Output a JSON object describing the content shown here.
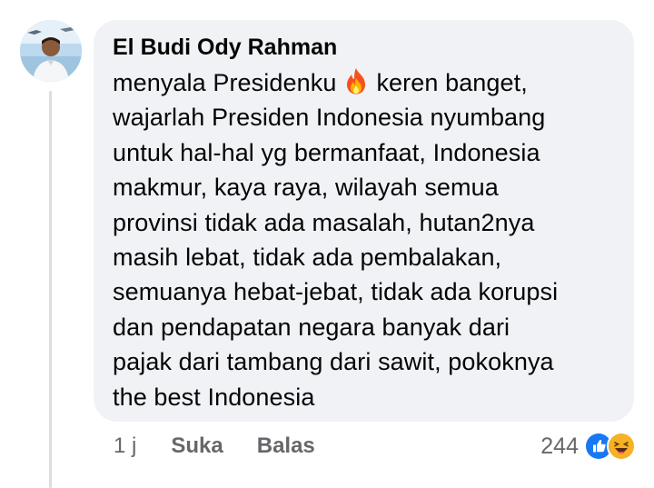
{
  "comment": {
    "author": "El Budi Ody Rahman",
    "lines": [
      {
        "before": "menyala Presidenku",
        "emoji": "fire-emoji",
        "after": "keren banget,"
      },
      {
        "text": "wajarlah Presiden Indonesia nyumbang"
      },
      {
        "text": "untuk hal-hal yg bermanfaat, Indonesia"
      },
      {
        "text": "makmur, kaya raya, wilayah semua"
      },
      {
        "text": "provinsi tidak ada masalah, hutan2nya"
      },
      {
        "text": "masih lebat, tidak ada pembalakan,"
      },
      {
        "text": "semuanya hebat-jebat, tidak ada korupsi"
      },
      {
        "text": "dan pendapatan negara banyak dari"
      },
      {
        "text": "pajak dari tambang dari sawit, pokoknya"
      },
      {
        "text": "the best Indonesia"
      }
    ]
  },
  "actions": {
    "time": "1 j",
    "like_label": "Suka",
    "reply_label": "Balas"
  },
  "reactions": {
    "count": "244",
    "icons": [
      "like-reaction-icon",
      "haha-reaction-icon"
    ]
  },
  "colors": {
    "bubble": "#f0f2f5",
    "text": "#050505",
    "muted": "#65676b",
    "like_blue": "#1877f2",
    "haha_yellow": "#f7b125"
  }
}
